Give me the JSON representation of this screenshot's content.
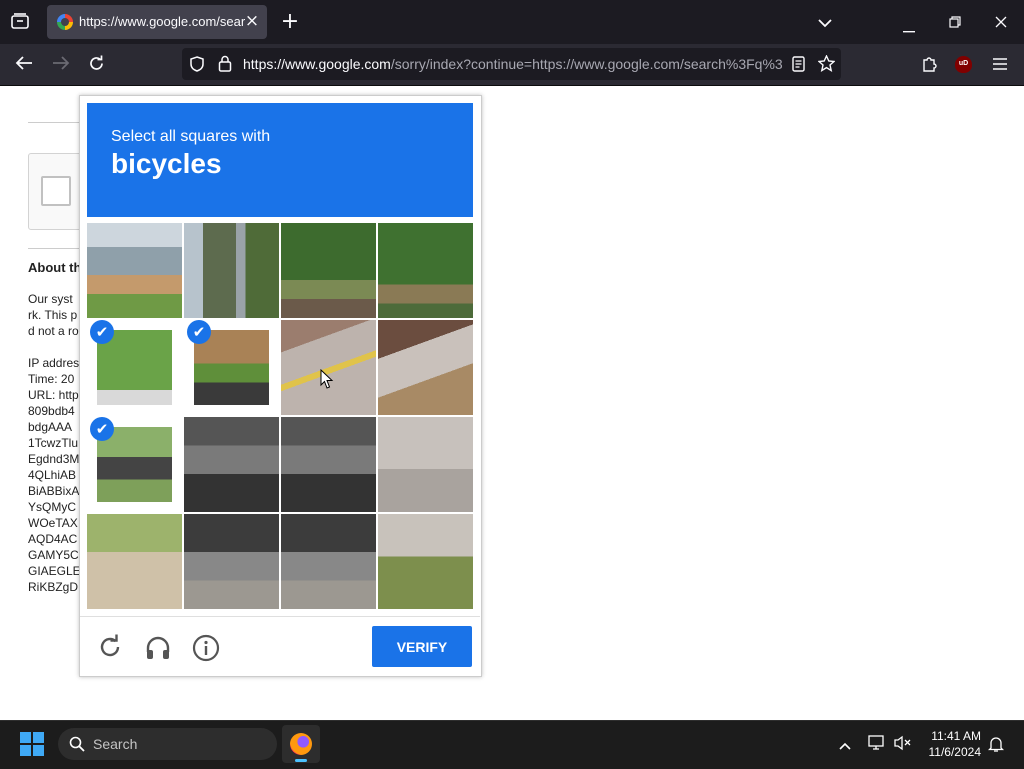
{
  "browser": {
    "tab_title": "https://www.google.com/search",
    "url_host": "https://www.google.com",
    "url_rest": "/sorry/index?continue=https://www.google.com/search%3Fq%3",
    "new_tab_symbol": "+",
    "tab_close_symbol": "×",
    "extension_badge": "uD"
  },
  "page": {
    "about_heading": "About th",
    "para_lines": [
      "Our syst",
      "rk. This p",
      "d not a ro"
    ],
    "ip_lines": [
      "IP addres",
      "Time: 20",
      "URL: http",
      "809bdb4",
      "bdgAAA",
      "1TcwzTlu",
      "Egdnd3M",
      "4QLhiAB",
      "BiABBixA",
      "YsQMyC",
      "WOeTAX",
      "AQD4AC",
      "GAMY5C",
      "GIAEGLE",
      "RiKBZgD"
    ]
  },
  "captcha": {
    "instruction": "Select all squares with",
    "target": "bicycles",
    "verify_label": "VERIFY",
    "tiles": [
      {
        "id": 1,
        "selected": false,
        "scene": "shelter-fence"
      },
      {
        "id": 2,
        "selected": false,
        "scene": "shelter-pole"
      },
      {
        "id": 3,
        "selected": false,
        "scene": "trees-track"
      },
      {
        "id": 4,
        "selected": false,
        "scene": "trees-pole"
      },
      {
        "id": 5,
        "selected": true,
        "scene": "grass"
      },
      {
        "id": 6,
        "selected": true,
        "scene": "fence-bike"
      },
      {
        "id": 7,
        "selected": false,
        "scene": "platform-yellow-line"
      },
      {
        "id": 8,
        "selected": false,
        "scene": "rail-fence"
      },
      {
        "id": 9,
        "selected": true,
        "scene": "bike-wheel"
      },
      {
        "id": 10,
        "selected": false,
        "scene": "bikes"
      },
      {
        "id": 11,
        "selected": false,
        "scene": "bikes"
      },
      {
        "id": 12,
        "selected": false,
        "scene": "platform-rail"
      },
      {
        "id": 13,
        "selected": false,
        "scene": "ground"
      },
      {
        "id": 14,
        "selected": false,
        "scene": "bikes-rack"
      },
      {
        "id": 15,
        "selected": false,
        "scene": "bikes-rack"
      },
      {
        "id": 16,
        "selected": false,
        "scene": "grass-rail"
      }
    ],
    "footer_icons": [
      "reload-icon",
      "headphones-icon",
      "info-icon"
    ]
  },
  "taskbar": {
    "search_label": "Search",
    "time": "11:41 AM",
    "date": "11/6/2024"
  },
  "colors": {
    "captcha_blue": "#1a73e8",
    "tabbar_bg": "#1c1b22",
    "navbar_bg": "#2b2a33",
    "taskbar_bg": "#1c1c1c"
  }
}
